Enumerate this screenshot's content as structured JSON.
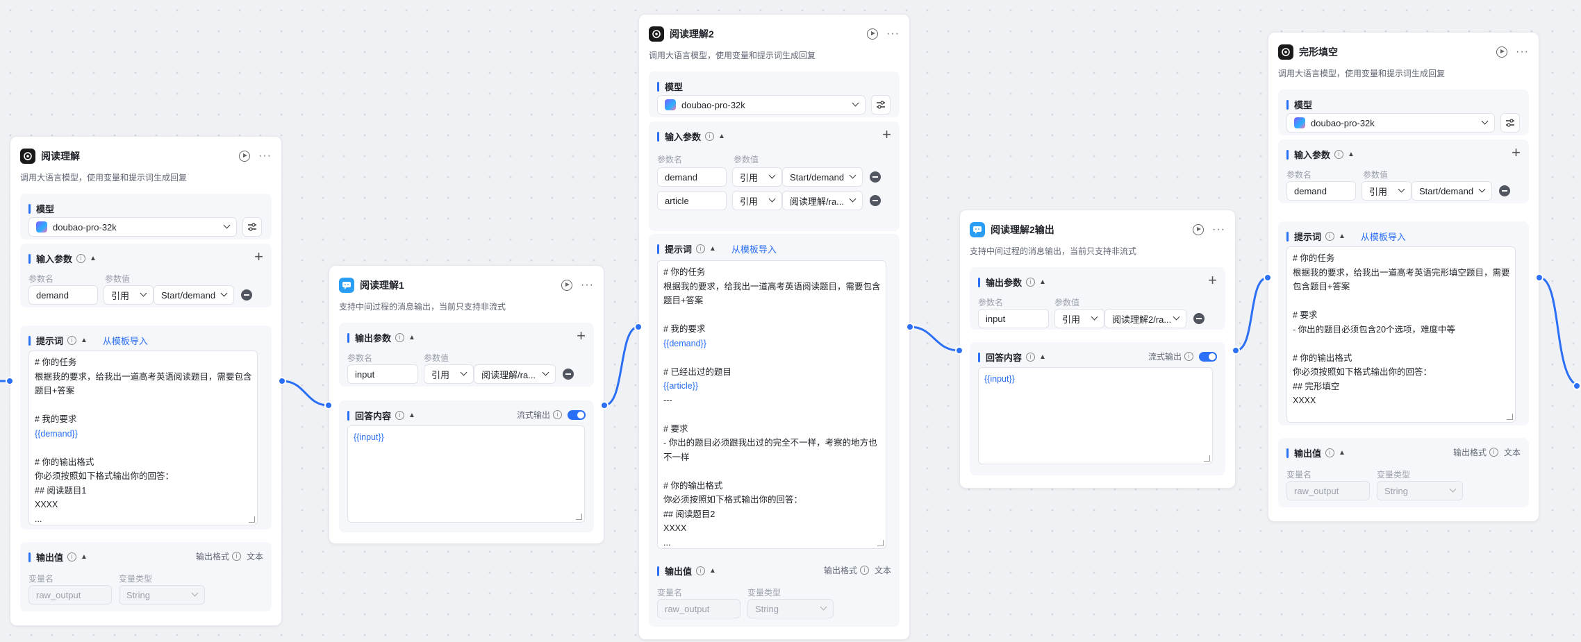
{
  "labels": {
    "model": "模型",
    "input_params": "输入参数",
    "output_params": "输出参数",
    "param_name": "参数名",
    "param_value": "参数值",
    "ref": "引用",
    "prompt": "提示词",
    "import_template": "从模板导入",
    "output_value": "输出值",
    "output_format": "输出格式",
    "text_type": "文本",
    "var_name": "变量名",
    "var_type": "变量类型",
    "answer_content": "回答内容",
    "stream_output": "流式输出"
  },
  "nodes": {
    "n1": {
      "title": "阅读理解",
      "desc": "调用大语言模型，使用变量和提示词生成回复",
      "model": "doubao-pro-32k",
      "inputs": [
        {
          "name": "demand",
          "ref": "Start/demand"
        }
      ],
      "prompt": [
        "# 你的任务",
        "根据我的要求，给我出一道高考英语阅读题目，需要包含",
        "题目+答案",
        "",
        "# 我的要求",
        "{{demand}}",
        "",
        "# 你的输出格式",
        "你必须按照如下格式输出你的回答：",
        "## 阅读题目1",
        "XXXX",
        "..."
      ],
      "output": {
        "name": "raw_output",
        "type": "String"
      }
    },
    "m1": {
      "title": "阅读理解1",
      "desc": "支持中间过程的消息输出，当前只支持非流式",
      "outputs": [
        {
          "name": "input",
          "ref": "阅读理解/ra..."
        }
      ],
      "answer": "{{input}}"
    },
    "n2": {
      "title": "阅读理解2",
      "desc": "调用大语言模型，使用变量和提示词生成回复",
      "model": "doubao-pro-32k",
      "inputs": [
        {
          "name": "demand",
          "ref": "Start/demand"
        },
        {
          "name": "article",
          "ref": "阅读理解/ra..."
        }
      ],
      "prompt": [
        "# 你的任务",
        "根据我的要求，给我出一道高考英语阅读题目，需要包含",
        "题目+答案",
        "",
        "# 我的要求",
        "{{demand}}",
        "",
        "# 已经出过的题目",
        "{{article}}",
        "---",
        "",
        "# 要求",
        "- 你出的题目必须跟我出过的完全不一样，考察的地方也",
        "不一样",
        "",
        "# 你的输出格式",
        "你必须按照如下格式输出你的回答：",
        "## 阅读题目2",
        "XXXX",
        "..."
      ],
      "output": {
        "name": "raw_output",
        "type": "String"
      }
    },
    "m2": {
      "title": "阅读理解2输出",
      "desc": "支持中间过程的消息输出，当前只支持非流式",
      "outputs": [
        {
          "name": "input",
          "ref": "阅读理解2/ra..."
        }
      ],
      "answer": "{{input}}"
    },
    "n3": {
      "title": "完形填空",
      "desc": "调用大语言模型，使用变量和提示词生成回复",
      "model": "doubao-pro-32k",
      "inputs": [
        {
          "name": "demand",
          "ref": "Start/demand"
        }
      ],
      "prompt": [
        "# 你的任务",
        "根据我的要求，给我出一道高考英语完形填空题目，需要",
        "包含题目+答案",
        "",
        "# 要求",
        "- 你出的题目必须包含20个选项，难度中等",
        "",
        "# 你的输出格式",
        "你必须按照如下格式输出你的回答：",
        "## 完形填空",
        "XXXX"
      ],
      "output": {
        "name": "raw_output",
        "type": "String"
      }
    }
  },
  "colors": {
    "accent": "#2a6ff5",
    "edge": "#2a6ff5",
    "canvas": "#f0f1f5"
  },
  "icons": {
    "llm": "openai-icon",
    "message": "chat-bubble-icon",
    "run": "play-icon",
    "more": "more-icon"
  }
}
